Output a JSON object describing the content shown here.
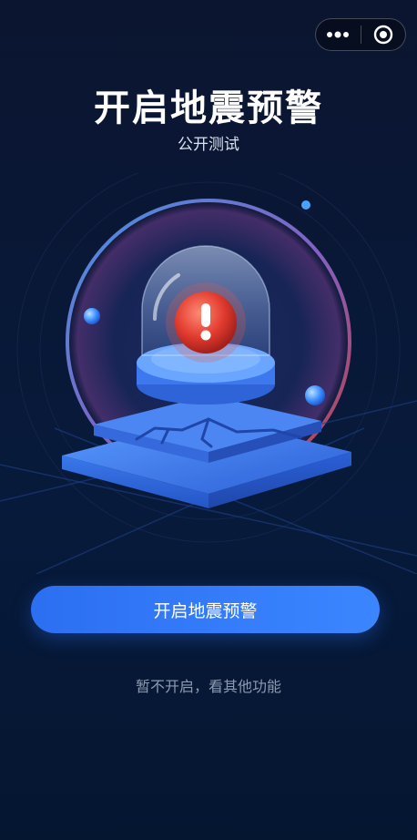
{
  "header": {
    "title": "开启地震预警",
    "subtitle": "公开测试"
  },
  "capsule": {
    "more_icon": "ellipsis-icon",
    "close_icon": "target-icon"
  },
  "hero": {
    "icon": "alarm-dome-illustration"
  },
  "actions": {
    "primary_label": "开启地震预警",
    "secondary_label": "暂不开启，看其他功能"
  },
  "colors": {
    "primary": "#3279f5",
    "background": "#0b1530",
    "alert": "#e23b2f"
  }
}
